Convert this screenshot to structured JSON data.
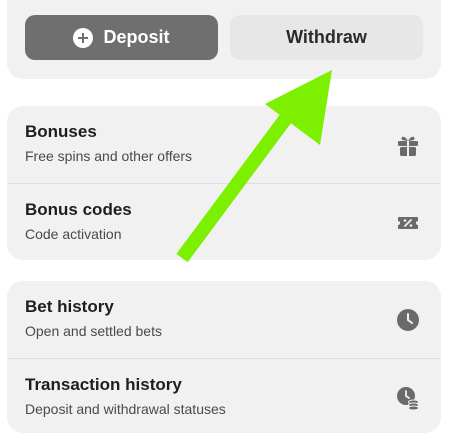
{
  "wallet": {
    "deposit_label": "Deposit",
    "withdraw_label": "Withdraw"
  },
  "bonus_section": {
    "items": [
      {
        "title": "Bonuses",
        "subtitle": "Free spins and other offers",
        "icon": "gift-icon"
      },
      {
        "title": "Bonus codes",
        "subtitle": "Code activation",
        "icon": "coupon-icon"
      }
    ]
  },
  "history_section": {
    "items": [
      {
        "title": "Bet history",
        "subtitle": "Open and settled bets",
        "icon": "clock-icon"
      },
      {
        "title": "Transaction history",
        "subtitle": "Deposit and withdrawal statuses",
        "icon": "clock-coins-icon"
      }
    ]
  },
  "colors": {
    "card_bg": "#f1f1f1",
    "deposit_bg": "#6f6f6f",
    "withdraw_bg": "#e7e7e7",
    "icon": "#6a6a6a",
    "annotation_arrow": "#7cf000"
  }
}
